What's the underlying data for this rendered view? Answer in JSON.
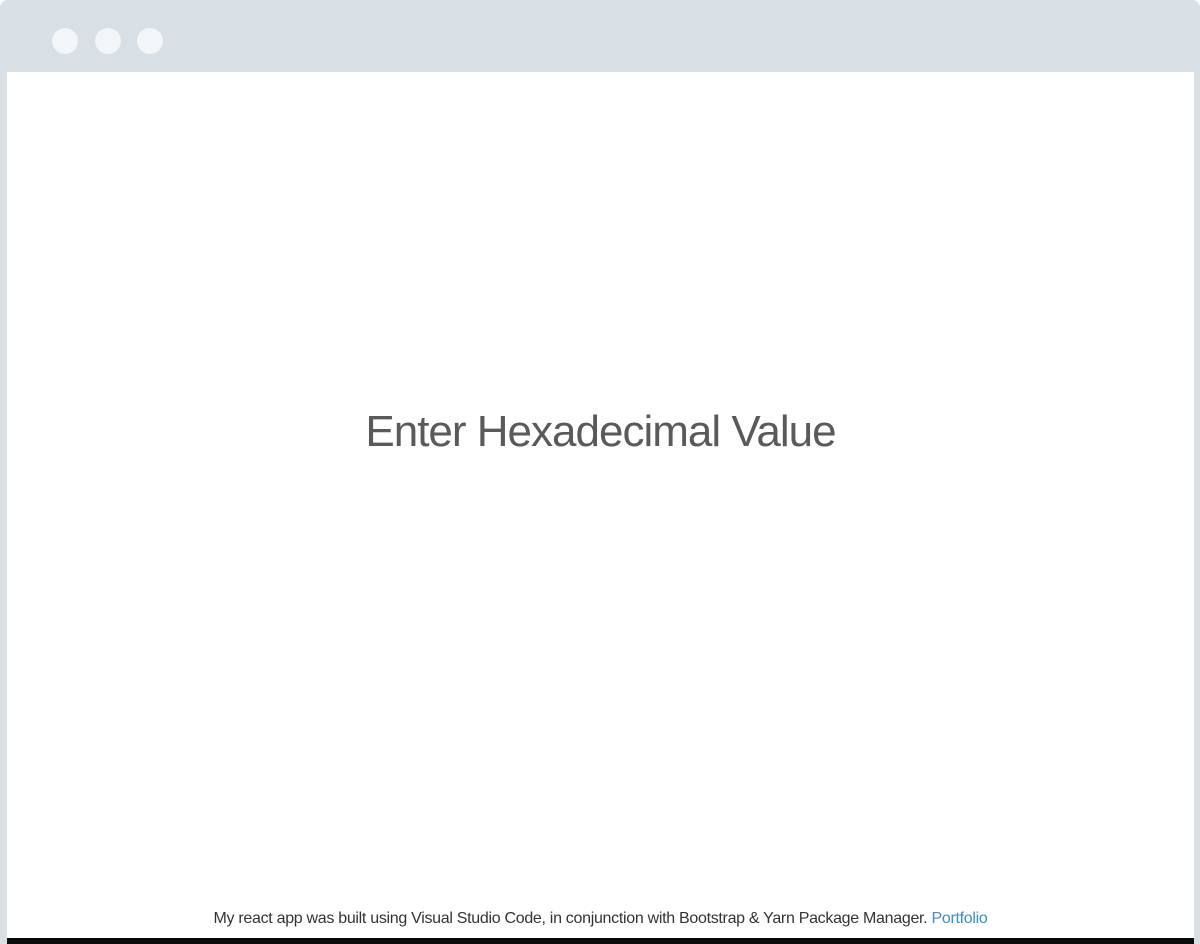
{
  "window": {
    "controls": [
      "close-dot",
      "minimize-dot",
      "maximize-dot"
    ]
  },
  "main": {
    "hex_input": {
      "placeholder": "Enter Hexadecimal Value",
      "value": ""
    }
  },
  "footer": {
    "text": "My react app was built using Visual Studio Code, in conjunction with Bootstrap & Yarn Package Manager.",
    "link_label": "Portfolio",
    "link_color": "#3a8fc9"
  },
  "colors": {
    "frame": "#d8e0e6",
    "background": "#ffffff"
  }
}
